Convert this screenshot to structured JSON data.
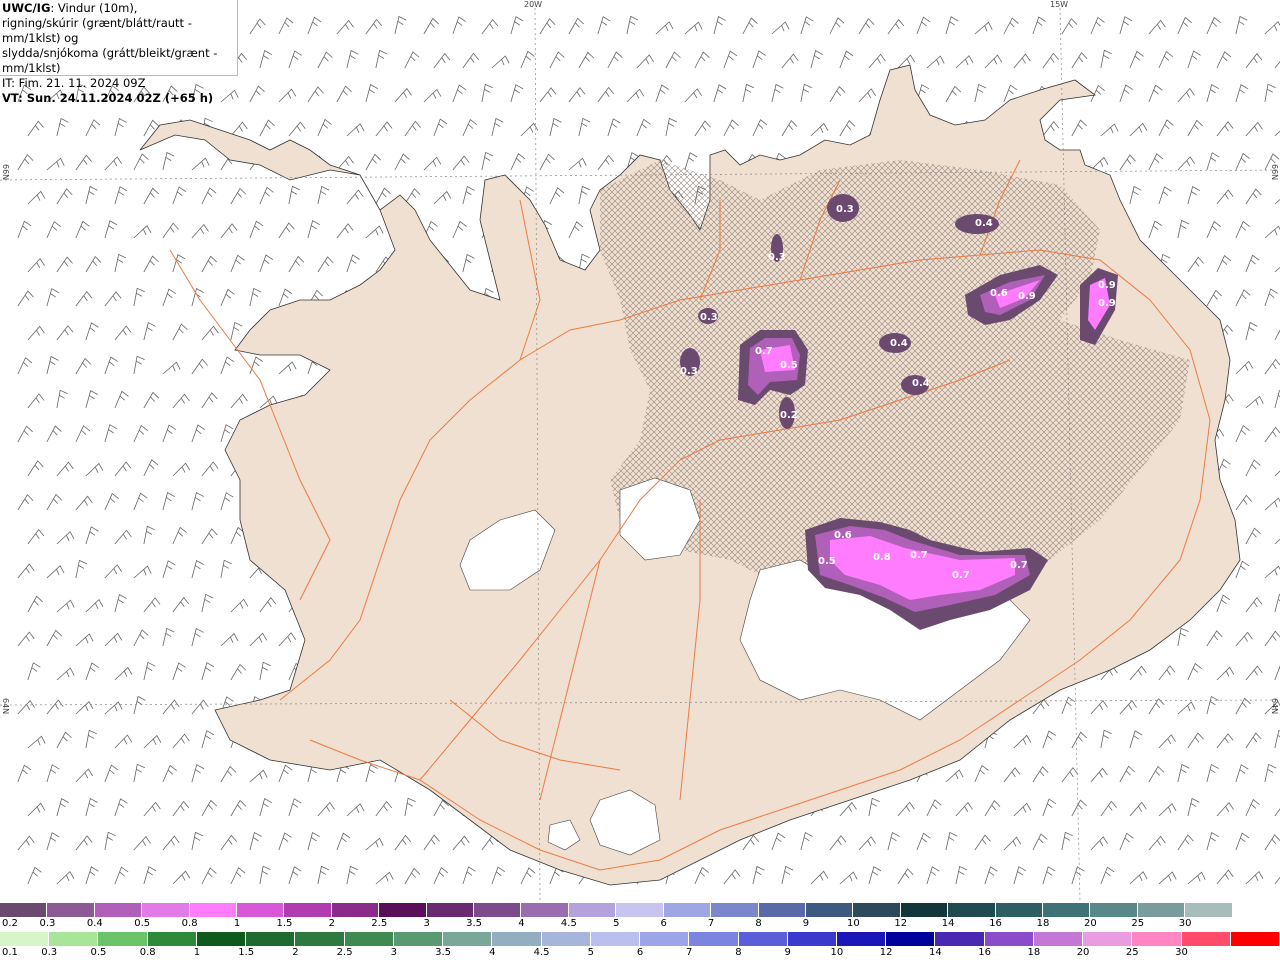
{
  "header": {
    "title_bold": "UWC/IG",
    "title_rest": ": Vindur (10m),",
    "line2": "rigning/skúrir (grænt/blátt/rautt - mm/1klst) og",
    "line3": "slydda/snjókoma (grátt/bleikt/grænt - mm/1klst)",
    "line4": "IT: Fim. 21. 11. 2024 09Z",
    "line5": "VT: Sun. 24.11.2024 02Z (+65 h)"
  },
  "grid_labels": {
    "lon_20w": "20W",
    "lon_15w": "15W",
    "lat_66n_left": "66N",
    "lat_66n_right": "66N",
    "lat_64n_left": "64N",
    "lat_64n_right": "64N"
  },
  "map_values": [
    {
      "label": "0.3"
    },
    {
      "label": "0.4"
    },
    {
      "label": "0.3"
    },
    {
      "label": "0.6"
    },
    {
      "label": "0.9"
    },
    {
      "label": "0.9"
    },
    {
      "label": "0.9"
    },
    {
      "label": "0.3"
    },
    {
      "label": "0.7"
    },
    {
      "label": "0.5"
    },
    {
      "label": "0.4"
    },
    {
      "label": "0.4"
    },
    {
      "label": "0.3"
    },
    {
      "label": "0.2"
    },
    {
      "label": "0.6"
    },
    {
      "label": "0.5"
    },
    {
      "label": "0.8"
    },
    {
      "label": "0.7"
    },
    {
      "label": "0.7"
    },
    {
      "label": "0.7"
    }
  ],
  "legend": {
    "snow": {
      "labels": [
        "0.2",
        "0.3",
        "0.4",
        "0.5",
        "0.8",
        "1",
        "1.5",
        "2",
        "2.5",
        "3",
        "3.5",
        "4",
        "4.5",
        "5",
        "6",
        "7",
        "8",
        "9",
        "10",
        "12",
        "14",
        "16",
        "18",
        "20",
        "25",
        "30"
      ],
      "colors": [
        "#6b4a70",
        "#8e5a95",
        "#b060b8",
        "#e27ae8",
        "#ff7cff",
        "#d858d8",
        "#b03cb0",
        "#8a2a8a",
        "#5a0f5a",
        "#6a2a72",
        "#7e4a8e",
        "#9a6cb2",
        "#b4a2dc",
        "#c8c4f0",
        "#9ea6e4",
        "#7c86cc",
        "#5a6aa8",
        "#3e5a80",
        "#2c4a5c",
        "#12363a",
        "#1f4a50",
        "#2e5e62",
        "#3e7274",
        "#5a8888",
        "#7a9c9c",
        "#a8bcbc",
        "#ffffff"
      ]
    },
    "rain": {
      "labels": [
        "0.1",
        "0.3",
        "0.5",
        "0.8",
        "1",
        "1.5",
        "2",
        "2.5",
        "3",
        "3.5",
        "4",
        "4.5",
        "5",
        "6",
        "7",
        "8",
        "9",
        "10",
        "12",
        "14",
        "16",
        "18",
        "20",
        "25",
        "30"
      ],
      "colors": [
        "#d6f5c8",
        "#a8e49a",
        "#6cc46a",
        "#2e8a3a",
        "#0e5a1a",
        "#1f6a2e",
        "#2e7a3e",
        "#3e8a50",
        "#5a9a72",
        "#7aa898",
        "#92aec0",
        "#a6b6da",
        "#bac0ee",
        "#9ea4ea",
        "#7c84e2",
        "#5a5ed8",
        "#3a3acc",
        "#1a16b8",
        "#00009c",
        "#4a28b2",
        "#8a4cc8",
        "#c278d4",
        "#ea9ce0",
        "#ff86c2",
        "#ff4c6a",
        "#ff0000"
      ]
    }
  },
  "colors": {
    "land": "#f0e0d2",
    "sea": "#ffffff",
    "roads": "#ee7a40",
    "glacier": "#ffffff",
    "precip_light": "#6b4a70",
    "precip_mid": "#b060b8",
    "precip_heavy": "#ff7cff"
  }
}
